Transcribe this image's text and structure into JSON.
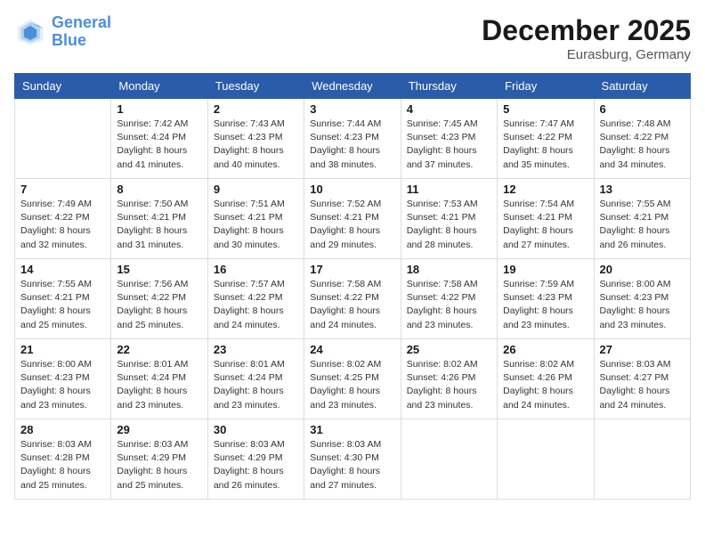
{
  "logo": {
    "line1": "General",
    "line2": "Blue"
  },
  "title": "December 2025",
  "location": "Eurasburg, Germany",
  "days_of_week": [
    "Sunday",
    "Monday",
    "Tuesday",
    "Wednesday",
    "Thursday",
    "Friday",
    "Saturday"
  ],
  "weeks": [
    [
      {
        "day": "",
        "info": []
      },
      {
        "day": "1",
        "info": [
          "Sunrise: 7:42 AM",
          "Sunset: 4:24 PM",
          "Daylight: 8 hours",
          "and 41 minutes."
        ]
      },
      {
        "day": "2",
        "info": [
          "Sunrise: 7:43 AM",
          "Sunset: 4:23 PM",
          "Daylight: 8 hours",
          "and 40 minutes."
        ]
      },
      {
        "day": "3",
        "info": [
          "Sunrise: 7:44 AM",
          "Sunset: 4:23 PM",
          "Daylight: 8 hours",
          "and 38 minutes."
        ]
      },
      {
        "day": "4",
        "info": [
          "Sunrise: 7:45 AM",
          "Sunset: 4:23 PM",
          "Daylight: 8 hours",
          "and 37 minutes."
        ]
      },
      {
        "day": "5",
        "info": [
          "Sunrise: 7:47 AM",
          "Sunset: 4:22 PM",
          "Daylight: 8 hours",
          "and 35 minutes."
        ]
      },
      {
        "day": "6",
        "info": [
          "Sunrise: 7:48 AM",
          "Sunset: 4:22 PM",
          "Daylight: 8 hours",
          "and 34 minutes."
        ]
      }
    ],
    [
      {
        "day": "7",
        "info": [
          "Sunrise: 7:49 AM",
          "Sunset: 4:22 PM",
          "Daylight: 8 hours",
          "and 32 minutes."
        ]
      },
      {
        "day": "8",
        "info": [
          "Sunrise: 7:50 AM",
          "Sunset: 4:21 PM",
          "Daylight: 8 hours",
          "and 31 minutes."
        ]
      },
      {
        "day": "9",
        "info": [
          "Sunrise: 7:51 AM",
          "Sunset: 4:21 PM",
          "Daylight: 8 hours",
          "and 30 minutes."
        ]
      },
      {
        "day": "10",
        "info": [
          "Sunrise: 7:52 AM",
          "Sunset: 4:21 PM",
          "Daylight: 8 hours",
          "and 29 minutes."
        ]
      },
      {
        "day": "11",
        "info": [
          "Sunrise: 7:53 AM",
          "Sunset: 4:21 PM",
          "Daylight: 8 hours",
          "and 28 minutes."
        ]
      },
      {
        "day": "12",
        "info": [
          "Sunrise: 7:54 AM",
          "Sunset: 4:21 PM",
          "Daylight: 8 hours",
          "and 27 minutes."
        ]
      },
      {
        "day": "13",
        "info": [
          "Sunrise: 7:55 AM",
          "Sunset: 4:21 PM",
          "Daylight: 8 hours",
          "and 26 minutes."
        ]
      }
    ],
    [
      {
        "day": "14",
        "info": [
          "Sunrise: 7:55 AM",
          "Sunset: 4:21 PM",
          "Daylight: 8 hours",
          "and 25 minutes."
        ]
      },
      {
        "day": "15",
        "info": [
          "Sunrise: 7:56 AM",
          "Sunset: 4:22 PM",
          "Daylight: 8 hours",
          "and 25 minutes."
        ]
      },
      {
        "day": "16",
        "info": [
          "Sunrise: 7:57 AM",
          "Sunset: 4:22 PM",
          "Daylight: 8 hours",
          "and 24 minutes."
        ]
      },
      {
        "day": "17",
        "info": [
          "Sunrise: 7:58 AM",
          "Sunset: 4:22 PM",
          "Daylight: 8 hours",
          "and 24 minutes."
        ]
      },
      {
        "day": "18",
        "info": [
          "Sunrise: 7:58 AM",
          "Sunset: 4:22 PM",
          "Daylight: 8 hours",
          "and 23 minutes."
        ]
      },
      {
        "day": "19",
        "info": [
          "Sunrise: 7:59 AM",
          "Sunset: 4:23 PM",
          "Daylight: 8 hours",
          "and 23 minutes."
        ]
      },
      {
        "day": "20",
        "info": [
          "Sunrise: 8:00 AM",
          "Sunset: 4:23 PM",
          "Daylight: 8 hours",
          "and 23 minutes."
        ]
      }
    ],
    [
      {
        "day": "21",
        "info": [
          "Sunrise: 8:00 AM",
          "Sunset: 4:23 PM",
          "Daylight: 8 hours",
          "and 23 minutes."
        ]
      },
      {
        "day": "22",
        "info": [
          "Sunrise: 8:01 AM",
          "Sunset: 4:24 PM",
          "Daylight: 8 hours",
          "and 23 minutes."
        ]
      },
      {
        "day": "23",
        "info": [
          "Sunrise: 8:01 AM",
          "Sunset: 4:24 PM",
          "Daylight: 8 hours",
          "and 23 minutes."
        ]
      },
      {
        "day": "24",
        "info": [
          "Sunrise: 8:02 AM",
          "Sunset: 4:25 PM",
          "Daylight: 8 hours",
          "and 23 minutes."
        ]
      },
      {
        "day": "25",
        "info": [
          "Sunrise: 8:02 AM",
          "Sunset: 4:26 PM",
          "Daylight: 8 hours",
          "and 23 minutes."
        ]
      },
      {
        "day": "26",
        "info": [
          "Sunrise: 8:02 AM",
          "Sunset: 4:26 PM",
          "Daylight: 8 hours",
          "and 24 minutes."
        ]
      },
      {
        "day": "27",
        "info": [
          "Sunrise: 8:03 AM",
          "Sunset: 4:27 PM",
          "Daylight: 8 hours",
          "and 24 minutes."
        ]
      }
    ],
    [
      {
        "day": "28",
        "info": [
          "Sunrise: 8:03 AM",
          "Sunset: 4:28 PM",
          "Daylight: 8 hours",
          "and 25 minutes."
        ]
      },
      {
        "day": "29",
        "info": [
          "Sunrise: 8:03 AM",
          "Sunset: 4:29 PM",
          "Daylight: 8 hours",
          "and 25 minutes."
        ]
      },
      {
        "day": "30",
        "info": [
          "Sunrise: 8:03 AM",
          "Sunset: 4:29 PM",
          "Daylight: 8 hours",
          "and 26 minutes."
        ]
      },
      {
        "day": "31",
        "info": [
          "Sunrise: 8:03 AM",
          "Sunset: 4:30 PM",
          "Daylight: 8 hours",
          "and 27 minutes."
        ]
      },
      {
        "day": "",
        "info": []
      },
      {
        "day": "",
        "info": []
      },
      {
        "day": "",
        "info": []
      }
    ]
  ]
}
